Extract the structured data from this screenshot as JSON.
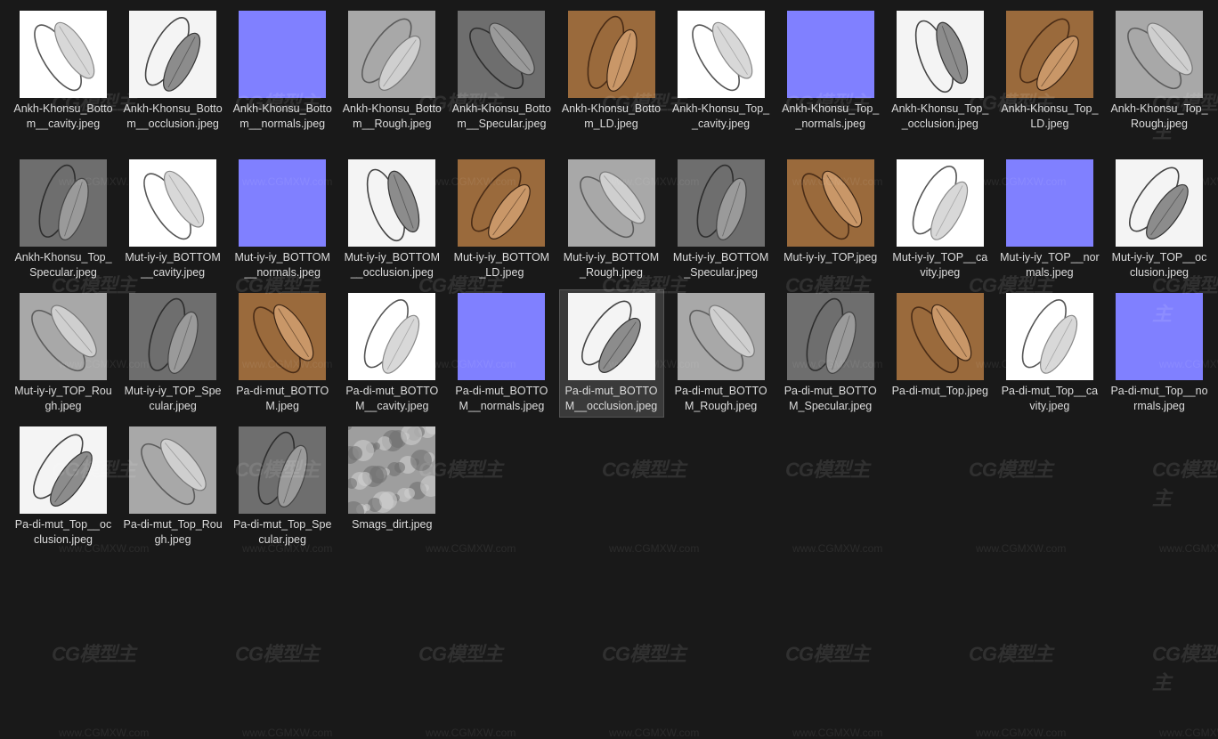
{
  "watermark": {
    "logo": "CG模型主",
    "url": "www.CGMXW.com"
  },
  "selected_index": 27,
  "files": [
    {
      "name": "Ankh-Khonsu_Bottom__cavity.jpeg",
      "style": "cavity"
    },
    {
      "name": "Ankh-Khonsu_Bottom__occlusion.jpeg",
      "style": "occlusion"
    },
    {
      "name": "Ankh-Khonsu_Bottom__normals.jpeg",
      "style": "normals"
    },
    {
      "name": "Ankh-Khonsu_Bottom__Rough.jpeg",
      "style": "rough"
    },
    {
      "name": "Ankh-Khonsu_Bottom__Specular.jpeg",
      "style": "specular"
    },
    {
      "name": "Ankh-Khonsu_Bottom_LD.jpeg",
      "style": "color"
    },
    {
      "name": "Ankh-Khonsu_Top__cavity.jpeg",
      "style": "cavity"
    },
    {
      "name": "Ankh-Khonsu_Top__normals.jpeg",
      "style": "normals"
    },
    {
      "name": "Ankh-Khonsu_Top__occlusion.jpeg",
      "style": "occlusion"
    },
    {
      "name": "Ankh-Khonsu_Top_LD.jpeg",
      "style": "color"
    },
    {
      "name": "Ankh-Khonsu_Top_Rough.jpeg",
      "style": "rough"
    },
    {
      "name": "Ankh-Khonsu_Top_Specular.jpeg",
      "style": "specular"
    },
    {
      "name": "Mut-iy-iy_BOTTOM__cavity.jpeg",
      "style": "cavity"
    },
    {
      "name": "Mut-iy-iy_BOTTOM__normals.jpeg",
      "style": "normals"
    },
    {
      "name": "Mut-iy-iy_BOTTOM__occlusion.jpeg",
      "style": "occlusion"
    },
    {
      "name": "Mut-iy-iy_BOTTOM_LD.jpeg",
      "style": "color"
    },
    {
      "name": "Mut-iy-iy_BOTTOM_Rough.jpeg",
      "style": "rough"
    },
    {
      "name": "Mut-iy-iy_BOTTOM_Specular.jpeg",
      "style": "specular"
    },
    {
      "name": "Mut-iy-iy_TOP.jpeg",
      "style": "color"
    },
    {
      "name": "Mut-iy-iy_TOP__cavity.jpeg",
      "style": "cavity"
    },
    {
      "name": "Mut-iy-iy_TOP__normals.jpeg",
      "style": "normals"
    },
    {
      "name": "Mut-iy-iy_TOP__occlusion.jpeg",
      "style": "occlusion"
    },
    {
      "name": "Mut-iy-iy_TOP_Rough.jpeg",
      "style": "rough"
    },
    {
      "name": "Mut-iy-iy_TOP_Specular.jpeg",
      "style": "specular"
    },
    {
      "name": "Pa-di-mut_BOTTOM.jpeg",
      "style": "color"
    },
    {
      "name": "Pa-di-mut_BOTTOM__cavity.jpeg",
      "style": "cavity"
    },
    {
      "name": "Pa-di-mut_BOTTOM__normals.jpeg",
      "style": "normals"
    },
    {
      "name": "Pa-di-mut_BOTTOM__occlusion.jpeg",
      "style": "occlusion"
    },
    {
      "name": "Pa-di-mut_BOTTOM_Rough.jpeg",
      "style": "rough"
    },
    {
      "name": "Pa-di-mut_BOTTOM_Specular.jpeg",
      "style": "specular"
    },
    {
      "name": "Pa-di-mut_Top.jpeg",
      "style": "color"
    },
    {
      "name": "Pa-di-mut_Top__cavity.jpeg",
      "style": "cavity"
    },
    {
      "name": "Pa-di-mut_Top__normals.jpeg",
      "style": "normals"
    },
    {
      "name": "Pa-di-mut_Top__occlusion.jpeg",
      "style": "occlusion"
    },
    {
      "name": "Pa-di-mut_Top_Rough.jpeg",
      "style": "rough"
    },
    {
      "name": "Pa-di-mut_Top_Specular.jpeg",
      "style": "specular"
    },
    {
      "name": "Smags_dirt.jpeg",
      "style": "dirt"
    }
  ]
}
